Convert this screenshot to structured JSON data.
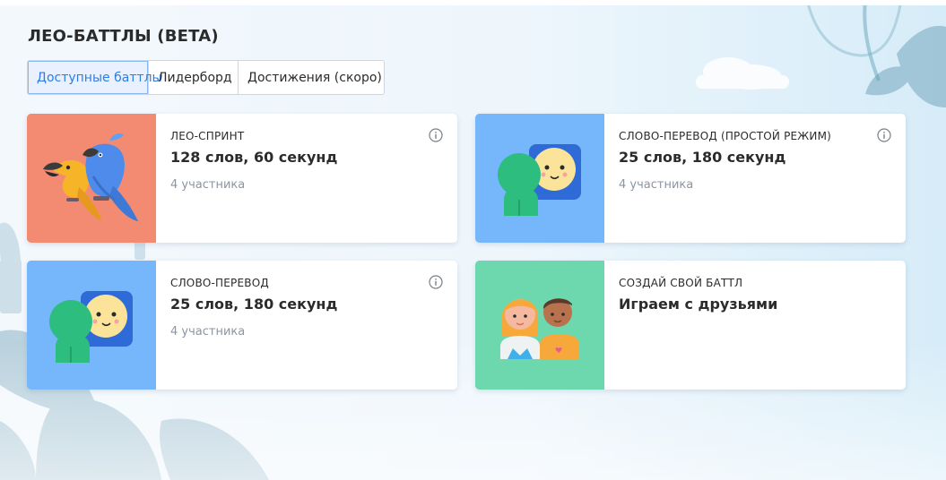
{
  "page": {
    "title": "ЛЕО-БАТТЛЫ (BETA)"
  },
  "tabs": [
    {
      "label": "Доступные баттлы",
      "active": true
    },
    {
      "label": "Лидерборд",
      "active": false
    },
    {
      "label": "Достижения (скоро)",
      "active": false
    }
  ],
  "cards": [
    {
      "title": "ЛЕО-СПРИНТ",
      "subtitle": "128 слов, 60 секунд",
      "participants": "4 участника",
      "thumb_color": "#f38a72",
      "illustration": "parrots-icon"
    },
    {
      "title": "СЛОВО-ПЕРЕВОД (ПРОСТОЙ РЕЖИМ)",
      "subtitle": "25 слов, 180 секунд",
      "participants": "4 участника",
      "thumb_color": "#76b7fb",
      "illustration": "chat-faces-icon"
    },
    {
      "title": "СЛОВО-ПЕРЕВОД",
      "subtitle": "25 слов, 180 секунд",
      "participants": "4 участника",
      "thumb_color": "#76b7fb",
      "illustration": "chat-faces-icon"
    },
    {
      "title": "СОЗДАЙ СВОЙ БАТТЛ",
      "subtitle": "Играем с друзьями",
      "participants": "",
      "thumb_color": "#6dd7ae",
      "illustration": "friends-icon"
    }
  ],
  "colors": {
    "accent": "#2f7de1",
    "text": "#2b2b2b",
    "muted": "#8a96a3"
  }
}
